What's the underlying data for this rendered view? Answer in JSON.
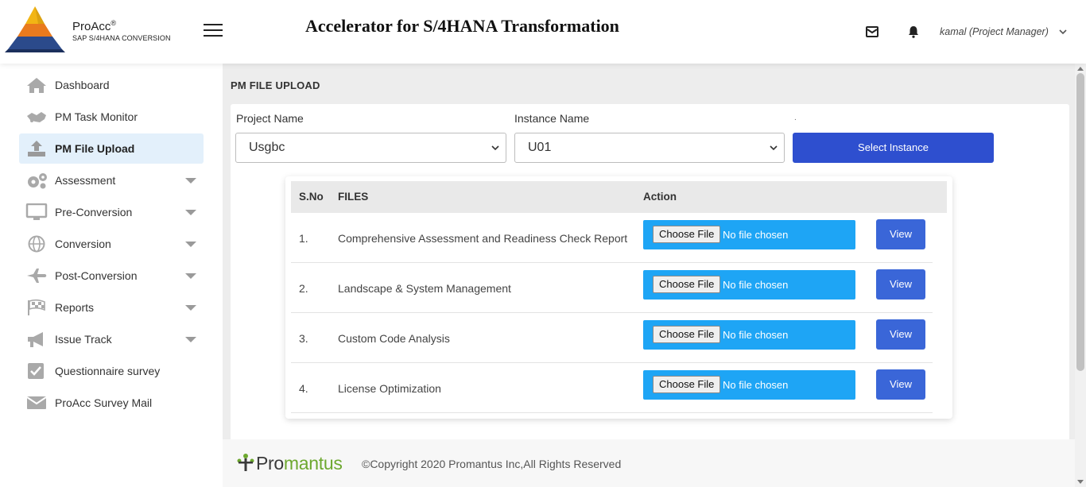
{
  "brand": {
    "name": "ProAcc",
    "reg": "®",
    "subtitle": "SAP S/4HANA CONVERSION"
  },
  "header": {
    "title": "Accelerator for S/4HANA Transformation",
    "user": "kamal (Project Manager)",
    "icons": [
      "mail-icon",
      "bell-icon",
      "chevron-down-icon"
    ]
  },
  "sidebar": {
    "items": [
      {
        "label": "Dashboard",
        "icon": "home-icon",
        "active": false,
        "expandable": false
      },
      {
        "label": "PM Task Monitor",
        "icon": "handshake-icon",
        "active": false,
        "expandable": false
      },
      {
        "label": "PM File Upload",
        "icon": "upload-icon",
        "active": true,
        "expandable": false
      },
      {
        "label": "Assessment",
        "icon": "gears-icon",
        "active": false,
        "expandable": true
      },
      {
        "label": "Pre-Conversion",
        "icon": "monitor-icon",
        "active": false,
        "expandable": true
      },
      {
        "label": "Conversion",
        "icon": "globe-icon",
        "active": false,
        "expandable": true
      },
      {
        "label": "Post-Conversion",
        "icon": "plane-icon",
        "active": false,
        "expandable": true
      },
      {
        "label": "Reports",
        "icon": "checkered-flag-icon",
        "active": false,
        "expandable": true
      },
      {
        "label": "Issue Track",
        "icon": "megaphone-icon",
        "active": false,
        "expandable": true
      },
      {
        "label": "Questionnaire survey",
        "icon": "check-square-icon",
        "active": false,
        "expandable": false
      },
      {
        "label": "ProAcc Survey Mail",
        "icon": "envelope-icon",
        "active": false,
        "expandable": false
      }
    ]
  },
  "page": {
    "heading": "PM FILE UPLOAD",
    "project": {
      "label": "Project Name",
      "value": "Usgbc"
    },
    "instance": {
      "label": "Instance Name",
      "value": "U01"
    },
    "select_label": "Select Instance",
    "dot": "."
  },
  "table": {
    "columns": {
      "sno": "S.No",
      "files": "FILES",
      "action": "Action"
    },
    "choose_label": "Choose File",
    "no_file_label": "No file chosen",
    "view_label": "View",
    "rows": [
      {
        "sno": "1.",
        "file": "Comprehensive Assessment and Readiness Check Report"
      },
      {
        "sno": "2.",
        "file": "Landscape & System Management"
      },
      {
        "sno": "3.",
        "file": "Custom Code Analysis"
      },
      {
        "sno": "4.",
        "file": "License Optimization"
      }
    ]
  },
  "footer": {
    "logo_pro": "Pro",
    "logo_mantus": "mantus",
    "copyright": "©Copyright 2020 Promantus Inc,All Rights Reserved"
  },
  "colors": {
    "primary": "#2e4fcf",
    "file_input": "#1ea5f5",
    "view_button": "#3a66d8",
    "active_nav": "#e3f0fb",
    "brand_green": "#6da82f"
  }
}
